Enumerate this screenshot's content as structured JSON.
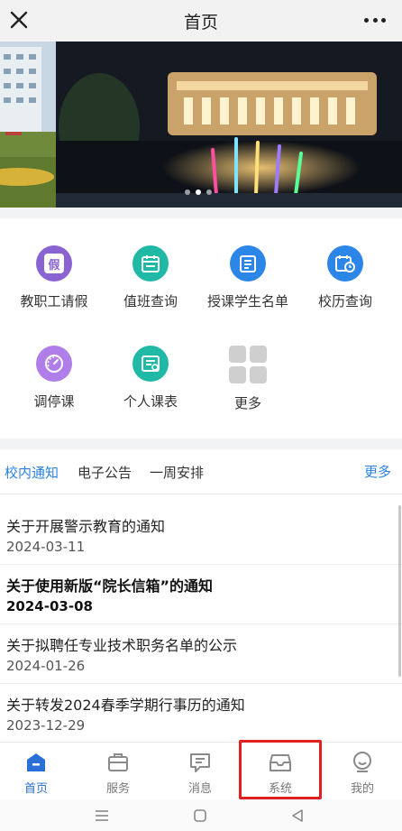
{
  "header": {
    "title": "首页"
  },
  "banner": {
    "dots": [
      false,
      true,
      false
    ]
  },
  "apps": [
    {
      "label": "教职工请假",
      "icon": "leave-icon",
      "color": "#8a63d2",
      "glyph": "假"
    },
    {
      "label": "值班查询",
      "icon": "calendar-icon",
      "color": "#1fb9a6",
      "glyph": ""
    },
    {
      "label": "授课学生名单",
      "icon": "list-icon",
      "color": "#2b86e8",
      "glyph": ""
    },
    {
      "label": "校历查询",
      "icon": "calendar-clock-icon",
      "color": "#2b86e8",
      "glyph": ""
    },
    {
      "label": "调停课",
      "icon": "gauge-icon",
      "color": "#b07ee8",
      "glyph": ""
    },
    {
      "label": "个人课表",
      "icon": "timetable-icon",
      "color": "#1fb9a6",
      "glyph": ""
    },
    {
      "label": "更多",
      "icon": "grid-more-icon",
      "color": "#c9c9c9",
      "glyph": ""
    }
  ],
  "tabs": {
    "items": [
      "校内通知",
      "电子公告",
      "一周安排"
    ],
    "more": "更多"
  },
  "news": [
    {
      "title": "关于开展警示教育的通知",
      "date": "2024-03-11",
      "bold": false
    },
    {
      "title": "关于使用新版“院长信箱”的通知",
      "date": "2024-03-08",
      "bold": true
    },
    {
      "title": "关于拟聘任专业技术职务名单的公示",
      "date": "2024-01-26",
      "bold": false
    },
    {
      "title": "关于转发2024春季学期行事历的通知",
      "date": "2023-12-29",
      "bold": false
    }
  ],
  "tabbar": [
    {
      "label": "首页",
      "icon": "home-icon",
      "active": true
    },
    {
      "label": "服务",
      "icon": "briefcase-icon",
      "active": false
    },
    {
      "label": "消息",
      "icon": "message-icon",
      "active": false
    },
    {
      "label": "系统",
      "icon": "inbox-icon",
      "active": false
    },
    {
      "label": "我的",
      "icon": "smiley-icon",
      "active": false
    }
  ],
  "colors": {
    "accent": "#2a82e4",
    "highlight": "#e02020"
  }
}
